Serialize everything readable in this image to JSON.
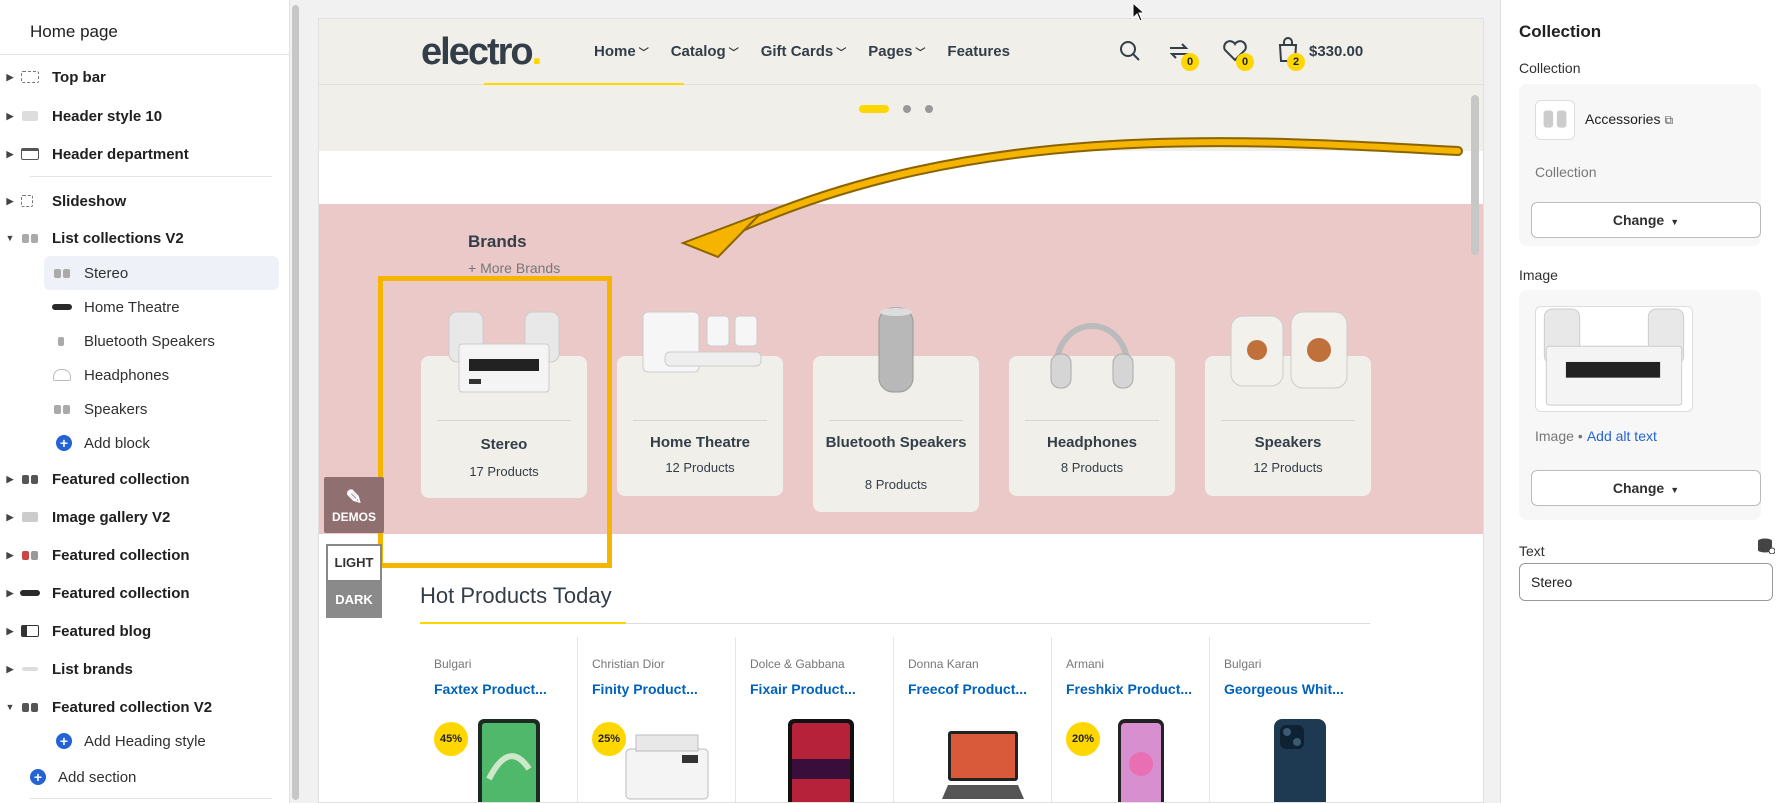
{
  "sidebar": {
    "title": "Home page",
    "sections": [
      {
        "label": "Top bar",
        "icon": "top-bar-icon"
      },
      {
        "label": "Header style 10",
        "icon": "header-icon"
      },
      {
        "label": "Header department",
        "icon": "header-department-icon"
      },
      {
        "label": "Slideshow",
        "icon": "slideshow-icon"
      },
      {
        "label": "List collections V2",
        "icon": "collections-icon",
        "expanded": true
      },
      {
        "label": "Featured collection",
        "icon": "featured-collection-icon"
      },
      {
        "label": "Image gallery V2",
        "icon": "image-gallery-icon"
      },
      {
        "label": "Featured collection",
        "icon": "featured-collection-icon"
      },
      {
        "label": "Featured collection",
        "icon": "featured-collection-icon"
      },
      {
        "label": "Featured blog",
        "icon": "blog-icon"
      },
      {
        "label": "List brands",
        "icon": "brands-icon"
      },
      {
        "label": "Featured collection V2",
        "icon": "featured-collection-icon",
        "expanded": true
      }
    ],
    "blocks": [
      {
        "label": "Stereo",
        "selected": true
      },
      {
        "label": "Home Theatre"
      },
      {
        "label": "Bluetooth Speakers"
      },
      {
        "label": "Headphones"
      },
      {
        "label": "Speakers"
      }
    ],
    "add_block": "Add block",
    "add_heading_style": "Add Heading style",
    "add_section": "Add section"
  },
  "store": {
    "logo_text": "electro",
    "logo_dot": ".",
    "nav": [
      "Home",
      "Catalog",
      "Gift Cards",
      "Pages",
      "Features"
    ],
    "compare_count": "0",
    "wishlist_count": "0",
    "cart_count": "2",
    "cart_total": "$330.00",
    "brands_title": "Brands",
    "brands_more": "+ More Brands",
    "collections": [
      {
        "title": "Stereo",
        "count": "17 Products"
      },
      {
        "title": "Home Theatre",
        "count": "12 Products"
      },
      {
        "title": "Bluetooth Speakers",
        "count": "8 Products"
      },
      {
        "title": "Headphones",
        "count": "8 Products"
      },
      {
        "title": "Speakers",
        "count": "12 Products"
      }
    ],
    "demos_label": "DEMOS",
    "light_label": "LIGHT",
    "dark_label": "DARK",
    "hot_title": "Hot Products Today",
    "products": [
      {
        "brand": "Bulgari",
        "name": "Faxtex Product...",
        "discount": "45%"
      },
      {
        "brand": "Christian Dior",
        "name": "Finity Product...",
        "discount": "25%"
      },
      {
        "brand": "Dolce & Gabbana",
        "name": "Fixair Product...",
        "discount": ""
      },
      {
        "brand": "Donna Karan",
        "name": "Freecof Product...",
        "discount": ""
      },
      {
        "brand": "Armani",
        "name": "Freshkix Product...",
        "discount": "20%"
      },
      {
        "brand": "Bulgari",
        "name": "Georgeous Whit...",
        "discount": ""
      }
    ]
  },
  "panel": {
    "title": "Collection",
    "collection_label": "Collection",
    "collection_name": "Accessories",
    "collection_sub": "Collection",
    "change_label": "Change",
    "image_label": "Image",
    "image_meta": "Image",
    "alt_text_link": "Add alt text",
    "text_label": "Text",
    "text_value": "Stereo"
  },
  "colors": {
    "accent_yellow": "#fed700",
    "annotation": "#f5b400",
    "link_blue": "#2463d5",
    "brands_band": "#ebc9c9"
  }
}
